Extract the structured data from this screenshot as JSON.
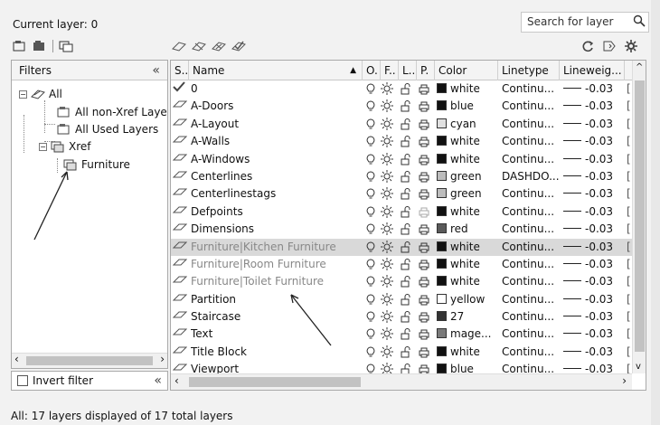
{
  "header": {
    "current_layer": "Current layer: 0",
    "search_placeholder": "Search for layer"
  },
  "filters": {
    "title": "Filters",
    "collapse_glyph": "«",
    "tree": {
      "all": "All",
      "non_xref": "All non-Xref Layers",
      "used": "All Used Layers",
      "xref": "Xref",
      "furniture": "Furniture"
    },
    "invert_label": "Invert filter"
  },
  "columns": {
    "status": "S..",
    "name": "Name",
    "on": "O.",
    "freeze": "F..",
    "lock": "L..",
    "plot": "P.",
    "color": "Color",
    "linetype": "Linetype",
    "lineweight": "Lineweig..."
  },
  "layers": [
    {
      "name": "0",
      "color": "white",
      "color_hex": "#111111",
      "linetype": "Continu...",
      "lineweight": "-0.03",
      "current": true
    },
    {
      "name": "A-Doors",
      "color": "blue",
      "color_hex": "#111111",
      "linetype": "Continu...",
      "lineweight": "-0.03"
    },
    {
      "name": "A-Layout",
      "color": "cyan",
      "color_hex": "#e0e0e0",
      "linetype": "Continu...",
      "lineweight": "-0.03"
    },
    {
      "name": "A-Walls",
      "color": "white",
      "color_hex": "#111111",
      "linetype": "Continu...",
      "lineweight": "-0.03"
    },
    {
      "name": "A-Windows",
      "color": "white",
      "color_hex": "#111111",
      "linetype": "Continu...",
      "lineweight": "-0.03"
    },
    {
      "name": "Centerlines",
      "color": "green",
      "color_hex": "#bdbdbd",
      "linetype": "DASHDO...",
      "lineweight": "-0.03"
    },
    {
      "name": "Centerlinestags",
      "color": "green",
      "color_hex": "#bdbdbd",
      "linetype": "Continu...",
      "lineweight": "-0.03"
    },
    {
      "name": "Defpoints",
      "color": "white",
      "color_hex": "#111111",
      "linetype": "Continu...",
      "lineweight": "-0.03",
      "noplot": true
    },
    {
      "name": "Dimensions",
      "color": "red",
      "color_hex": "#5a5a5a",
      "linetype": "Continu...",
      "lineweight": "-0.03"
    },
    {
      "name": "Furniture|Kitchen Furniture",
      "color": "white",
      "color_hex": "#111111",
      "linetype": "Continu...",
      "lineweight": "-0.03",
      "selected": true,
      "xref": true
    },
    {
      "name": "Furniture|Room Furniture",
      "color": "white",
      "color_hex": "#111111",
      "linetype": "Continu...",
      "lineweight": "-0.03",
      "xref": true
    },
    {
      "name": "Furniture|Toilet Furniture",
      "color": "white",
      "color_hex": "#111111",
      "linetype": "Continu...",
      "lineweight": "-0.03",
      "xref": true
    },
    {
      "name": "Partition",
      "color": "yellow",
      "color_hex": "#ffffff",
      "linetype": "Continu...",
      "lineweight": "-0.03"
    },
    {
      "name": "Staircase",
      "color": "27",
      "color_hex": "#333333",
      "linetype": "Continu...",
      "lineweight": "-0.03"
    },
    {
      "name": "Text",
      "color": "mage...",
      "color_hex": "#7a7a7a",
      "linetype": "Continu...",
      "lineweight": "-0.03"
    },
    {
      "name": "Title Block",
      "color": "white",
      "color_hex": "#111111",
      "linetype": "Continu...",
      "lineweight": "-0.03"
    },
    {
      "name": "Viewport",
      "color": "blue",
      "color_hex": "#111111",
      "linetype": "Continu...",
      "lineweight": "-0.03"
    }
  ],
  "status_text": "All: 17 layers displayed of 17 total layers"
}
